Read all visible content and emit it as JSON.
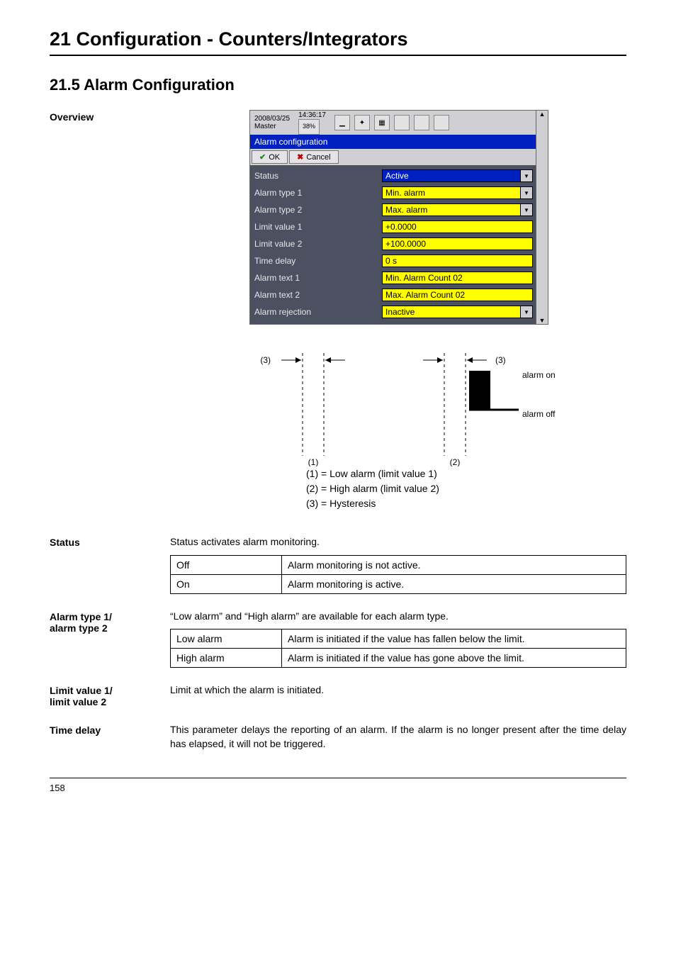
{
  "chapter_title": "21 Configuration - Counters/Integrators",
  "section_title": "21.5   Alarm Configuration",
  "labels": {
    "overview": "Overview",
    "status": "Status",
    "alarm_type": "Alarm type 1/\nalarm type 2",
    "limit_value": "Limit value 1/\nlimit value 2",
    "time_delay": "Time delay"
  },
  "dialog": {
    "header_date": "2008/03/25",
    "header_time": "14:36:17",
    "header_master": "Master",
    "header_badge": "38%",
    "titlebar": "Alarm configuration",
    "btn_ok": "OK",
    "btn_cancel": "Cancel",
    "rows": [
      {
        "label": "Status",
        "value": "Active",
        "style": "blue",
        "dropdown": true
      },
      {
        "label": "Alarm type 1",
        "value": "Min. alarm",
        "style": "yellow",
        "dropdown": true
      },
      {
        "label": "Alarm type 2",
        "value": "Max. alarm",
        "style": "yellow",
        "dropdown": true
      },
      {
        "label": "Limit value 1",
        "value": "+0.0000",
        "style": "yellow",
        "dropdown": false
      },
      {
        "label": "Limit value 2",
        "value": "+100.0000",
        "style": "yellow",
        "dropdown": false
      },
      {
        "label": "Time delay",
        "value": "0 s",
        "style": "yellow",
        "dropdown": false
      },
      {
        "label": "Alarm text 1",
        "value": "Min. Alarm Count 02",
        "style": "yellow",
        "dropdown": false
      },
      {
        "label": "Alarm text 2",
        "value": "Max. Alarm Count 02",
        "style": "yellow",
        "dropdown": false
      },
      {
        "label": "Alarm rejection",
        "value": "Inactive",
        "style": "yellow",
        "dropdown": true
      }
    ]
  },
  "diagram": {
    "marker_3_left": "(3)",
    "marker_3_right": "(3)",
    "marker_1": "(1)",
    "marker_2": "(2)",
    "alarm_on": "alarm on",
    "alarm_off": "alarm off",
    "legend_1": "(1) = Low alarm (limit value 1)",
    "legend_2": "(2) = High alarm (limit value 2)",
    "legend_3": "(3) = Hysteresis"
  },
  "status_text": "Status activates alarm monitoring.",
  "status_table": [
    {
      "key": "Off",
      "val": "Alarm monitoring is not active."
    },
    {
      "key": "On",
      "val": "Alarm monitoring is active."
    }
  ],
  "alarm_type_text": "“Low alarm” and “High alarm” are available for each alarm type.",
  "alarm_type_table": [
    {
      "key": "Low alarm",
      "val": "Alarm is initiated if the value has fallen below the limit."
    },
    {
      "key": "High alarm",
      "val": "Alarm is initiated if the value has gone above the limit."
    }
  ],
  "limit_value_text": "Limit at which the alarm is initiated.",
  "time_delay_text": "This parameter delays the reporting of an alarm. If the alarm is no longer present after the time delay has elapsed, it will not be triggered.",
  "page_number": "158"
}
